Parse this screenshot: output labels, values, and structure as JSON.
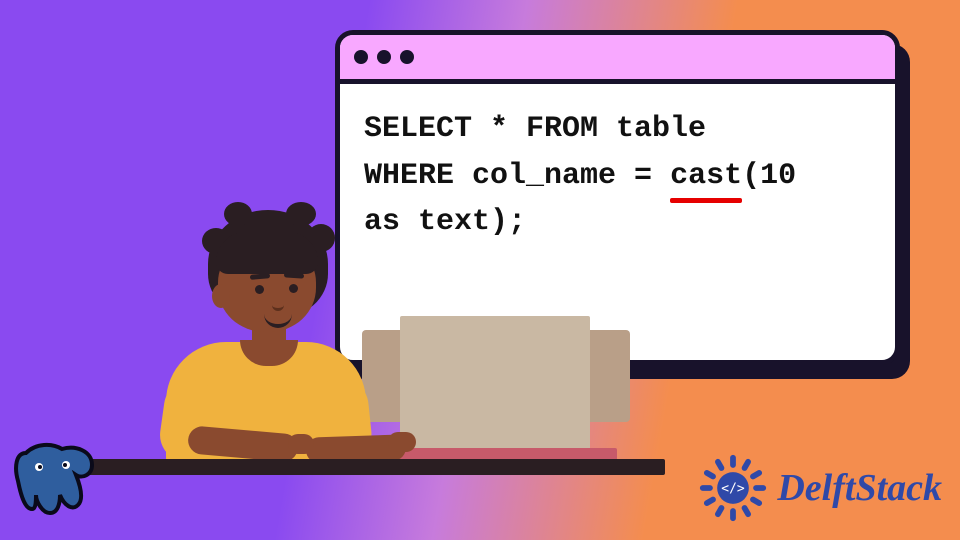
{
  "code": {
    "line1_a": "SELECT * FROM table",
    "line2_a": "WHERE col_name = ",
    "line2_cast": "cast",
    "line2_b": "(10",
    "line3": "as text);"
  },
  "brand": {
    "name": "DelftStack"
  }
}
